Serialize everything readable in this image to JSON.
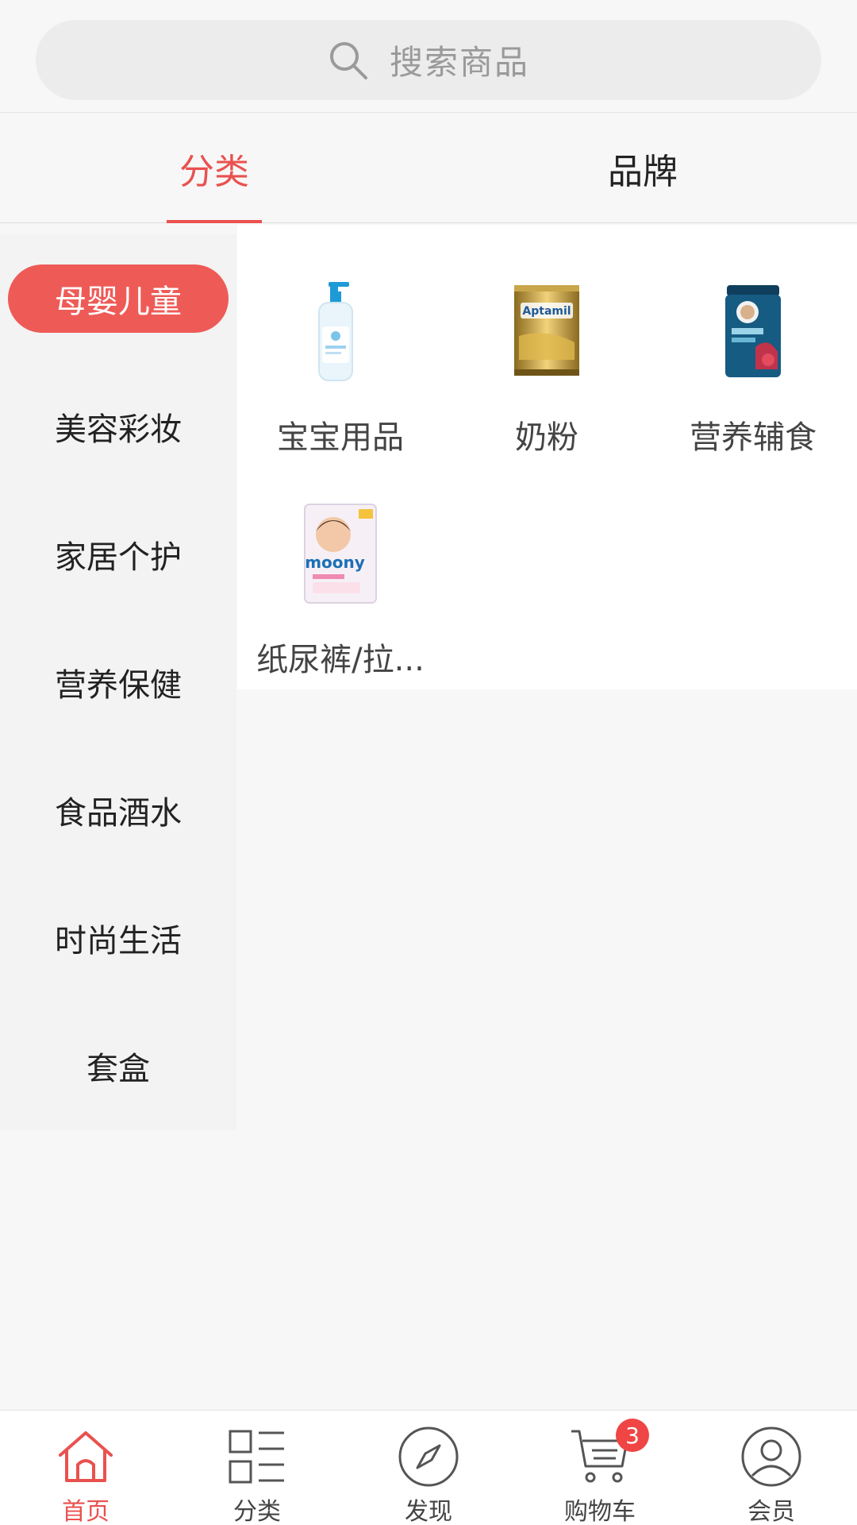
{
  "search": {
    "placeholder": "搜索商品"
  },
  "tabs": [
    {
      "label": "分类",
      "active": true
    },
    {
      "label": "品牌",
      "active": false
    }
  ],
  "categories": [
    {
      "label": "母婴儿童",
      "active": true
    },
    {
      "label": "美容彩妆",
      "active": false
    },
    {
      "label": "家居个护",
      "active": false
    },
    {
      "label": "营养保健",
      "active": false
    },
    {
      "label": "食品酒水",
      "active": false
    },
    {
      "label": "时尚生活",
      "active": false
    },
    {
      "label": "套盒",
      "active": false
    }
  ],
  "subcategories": [
    {
      "label": "宝宝用品",
      "icon": "baby-wash-bottle-image"
    },
    {
      "label": "奶粉",
      "icon": "milk-powder-can-image",
      "brand_text": "Aptamil"
    },
    {
      "label": "营养辅食",
      "icon": "baby-cereal-canister-image"
    },
    {
      "label": "纸尿裤/拉...",
      "icon": "diaper-pack-image",
      "brand_text": "moony"
    }
  ],
  "bottom_nav": [
    {
      "label": "首页",
      "icon": "home-icon",
      "active": true
    },
    {
      "label": "分类",
      "icon": "category-list-icon",
      "active": false
    },
    {
      "label": "发现",
      "icon": "compass-icon",
      "active": false
    },
    {
      "label": "购物车",
      "icon": "cart-icon",
      "active": false,
      "badge": "3"
    },
    {
      "label": "会员",
      "icon": "user-icon",
      "active": false
    }
  ],
  "colors": {
    "accent": "#e9514f",
    "active_category_bg": "#ee5b57",
    "badge": "#f04545",
    "background": "#f7f7f7"
  }
}
